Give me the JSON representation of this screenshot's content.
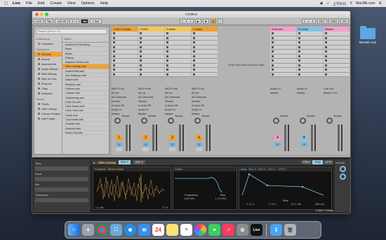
{
  "menubar": {
    "app": "Live",
    "items": [
      "File",
      "Edit",
      "Create",
      "View",
      "Options",
      "Help"
    ],
    "clock": "上午8:11",
    "site": "MacWk.com"
  },
  "desktop": {
    "folder_label": "MacWk.com"
  },
  "window": {
    "title": "Untitled"
  },
  "transport": {
    "link": "Link",
    "tap": "Tap",
    "tempo": "120.00",
    "sig": "4 / 4",
    "bar": "1 Bar",
    "position": "1 . 1 . 1",
    "loop_start": "1 . 1 . 1",
    "key": "KEY",
    "midi": "MIDI",
    "cpu": "1%"
  },
  "browser": {
    "search_placeholder": "Search (Cmd + F)",
    "collections_header": "Collections",
    "favorites": "Favorites",
    "categories_header": "Categories",
    "categories": [
      "Sounds",
      "Drums",
      "Instruments",
      "Audio Effects",
      "MIDI Effects",
      "Max for Live",
      "Plug-Ins",
      "Clips",
      "Samples"
    ],
    "places_header": "Places",
    "places": [
      "Packs",
      "User Library",
      "Current Project",
      "Add Folder..."
    ],
    "name_header": "Name",
    "files": [
      "Ambient & Evolving",
      "Bass",
      "Brass",
      "Effects",
      "Airplane Noise.adv",
      "Alien Gossip.adv",
      "AmbientHit.adv",
      "Am Wahyupr.adv",
      "Attack.adv",
      "BeepUp.adv",
      "Chimes.adv",
      "Clacker.adv",
      "Clankering.adv",
      "Click-An.adv",
      "Click Noise.adv",
      "Click Tone.adv",
      "Cycle.adv",
      "Copocade.adv",
      "Crackle.adv",
      "Darkbell.adv",
      "Dead City.adv"
    ],
    "selected_file": "Alien Gossip.adv"
  },
  "session": {
    "tracks": [
      {
        "name": "1 Alien Gossip",
        "color": "#f0a030"
      },
      {
        "name": "2 MIDI",
        "color": "#f6c65b"
      },
      {
        "name": "3 Audio",
        "color": "#f6c65b"
      },
      {
        "name": "4 Audio",
        "color": "#f0a030"
      },
      {
        "name": "A Reverb",
        "color": "#f0a0c8"
      },
      {
        "name": "B Delay",
        "color": "#7fc3ea"
      },
      {
        "name": "Master",
        "color": "#f0a0c8"
      }
    ],
    "drop_text": "Drop Files and Devices Here",
    "midi_from": "MIDI From",
    "all_ins": "All Ins",
    "all_channels": "All Channels",
    "monitor": "Monitor",
    "in_auto_off": "In  Auto  Off",
    "audio_to": "Audio To",
    "master": "Master",
    "sends": "Sends",
    "track_numbers": [
      "1",
      "2",
      "3",
      "4",
      "A",
      "B"
    ],
    "solo": "S",
    "cue_out": "Cue Out",
    "master_out": "Master Out"
  },
  "device": {
    "name": "Alien Gossip",
    "tabs": [
      "Osc 1",
      "Osc 2",
      "Filter",
      "Amp",
      "LFO"
    ],
    "panels": {
      "formant": "Formant",
      "harsh_vowel": "Harsh Vowel",
      "filter_mode": "Clean",
      "filter_freq": "Frequency",
      "filter_res": "Res",
      "amp": "Amp",
      "env2": "Env 2",
      "env3": "Env 3",
      "lfo1": "LFO 1",
      "lfo2": "LFO 2",
      "time": "Time",
      "values": [
        "0.0 dB",
        "72 %",
        "3.96 kHz",
        "1.19 kHz",
        "2.71 s",
        "1.79 s",
        "-27.1 dB",
        "285 ms"
      ]
    },
    "left_labels": [
      "Time",
      "Drive",
      "Mix",
      "Transpose"
    ],
    "right_label": "Volume",
    "status": "1-Alien Gossip"
  },
  "dock": {
    "apps": [
      "Finder",
      "Launchpad",
      "Chrome",
      "Preview",
      "Safari",
      "Mail",
      "Calendar",
      "Notes",
      "Reminders",
      "Photos",
      "Messages",
      "Music",
      "System Preferences",
      "Live",
      "Downloads",
      "Trash"
    ],
    "calendar_day": "24"
  }
}
